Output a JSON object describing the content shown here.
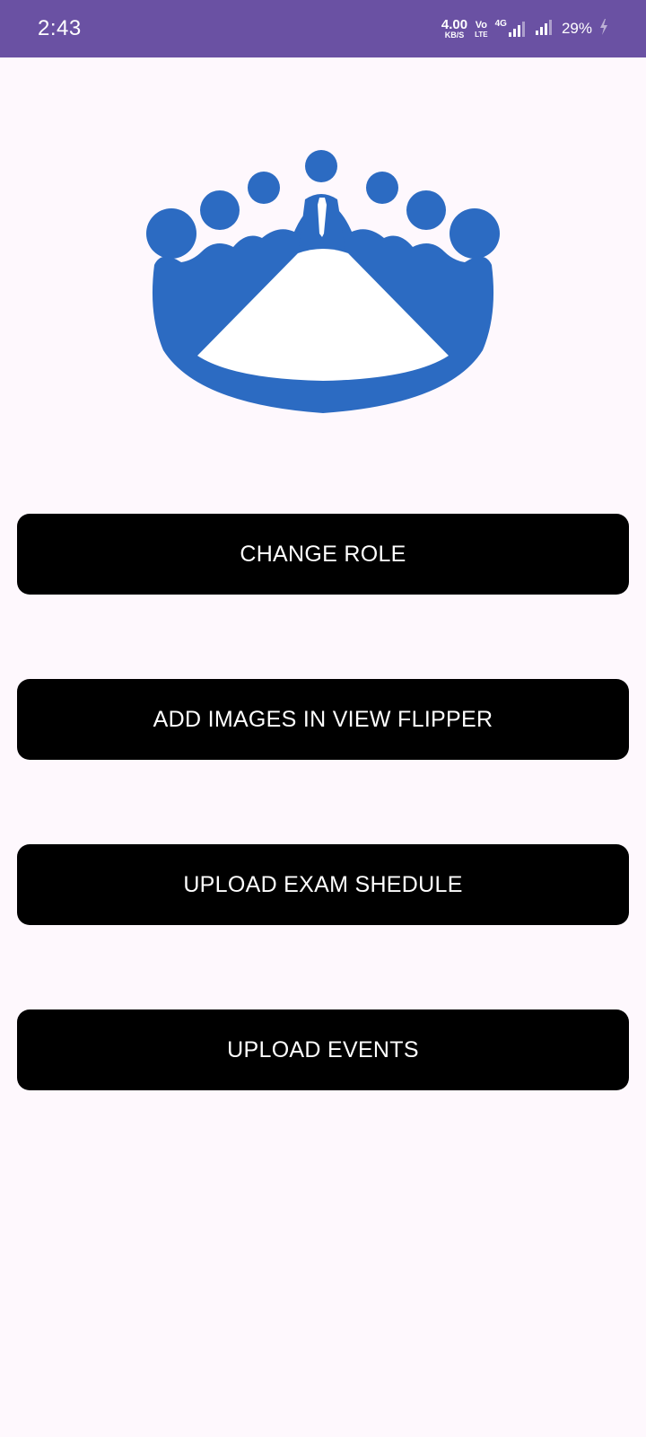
{
  "status_bar": {
    "time": "2:43",
    "net_speed_value": "4.00",
    "net_speed_unit": "KB/S",
    "volte_top": "Vo",
    "volte_bottom": "LTE",
    "network_type": "4G",
    "battery": "29%",
    "background_color": "#6A51A3"
  },
  "logo": {
    "icon": "meeting-table-people-icon",
    "color": "#2C6BC2"
  },
  "actions": {
    "change_role": "CHANGE ROLE",
    "add_images": "ADD IMAGES IN VIEW FLIPPER",
    "upload_exam": "UPLOAD EXAM SHEDULE",
    "upload_events": "UPLOAD EVENTS"
  },
  "colors": {
    "page_background": "#FEF8FD",
    "button_background": "#000000",
    "button_text": "#FFFFFF"
  }
}
